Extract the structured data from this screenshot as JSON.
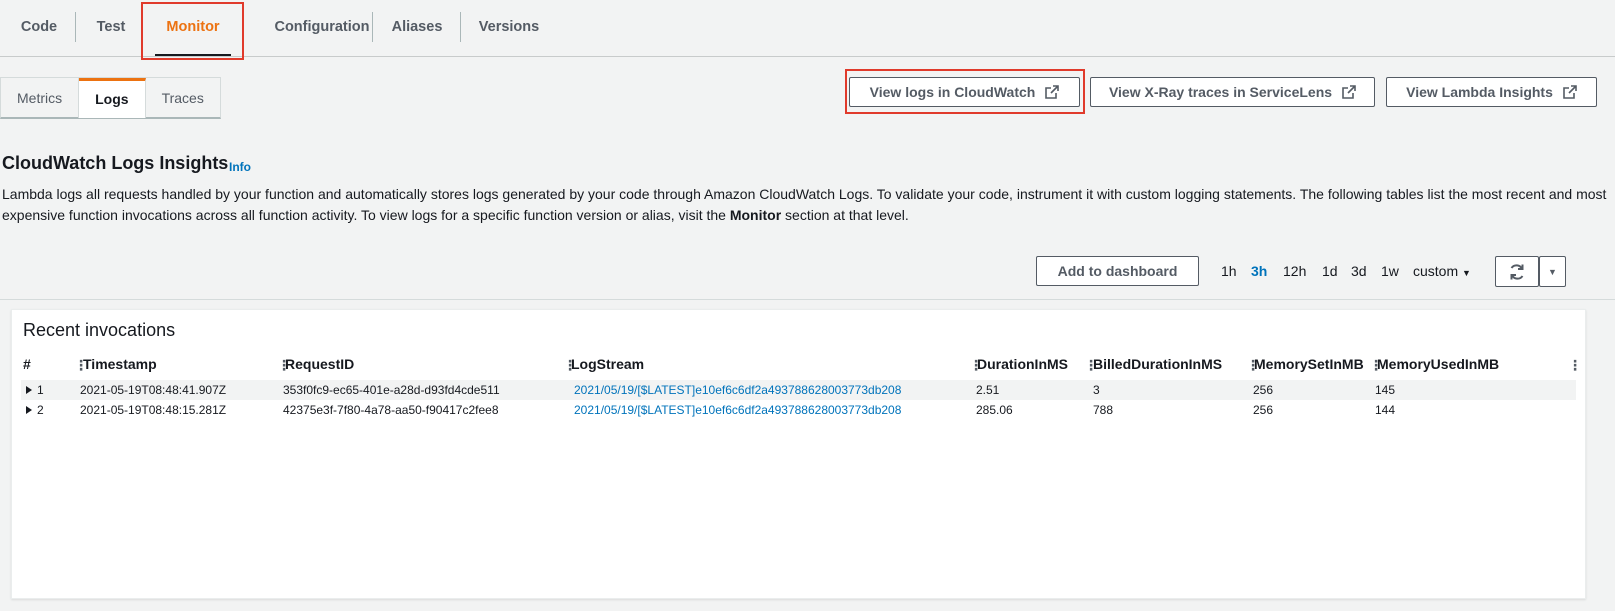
{
  "top_tabs": [
    {
      "label": "Code"
    },
    {
      "label": "Test"
    },
    {
      "label": "Monitor"
    },
    {
      "label": "Configuration"
    },
    {
      "label": "Aliases"
    },
    {
      "label": "Versions"
    }
  ],
  "sub_tabs": [
    {
      "label": "Metrics"
    },
    {
      "label": "Logs"
    },
    {
      "label": "Traces"
    }
  ],
  "actions": {
    "view_logs": "View logs in CloudWatch",
    "view_xray": "View X-Ray traces in ServiceLens",
    "view_insights": "View Lambda Insights"
  },
  "section": {
    "title": "CloudWatch Logs Insights",
    "info": "Info",
    "desc_part1": "Lambda logs all requests handled by your function and automatically stores logs generated by your code through Amazon CloudWatch Logs. To validate your code, instrument it with custom logging statements. The following tables list the most recent and most expensive function invocations across all function activity. To view logs for a specific function version or alias, visit the ",
    "desc_bold": "Monitor",
    "desc_part2": " section at that level."
  },
  "toolbar": {
    "add_dashboard": "Add to dashboard",
    "ranges": [
      "1h",
      "3h",
      "12h",
      "1d",
      "3d",
      "1w"
    ],
    "selected_range": "3h",
    "custom": "custom"
  },
  "table": {
    "title": "Recent invocations",
    "columns": [
      "#",
      "Timestamp",
      "RequestID",
      "LogStream",
      "DurationInMS",
      "BilledDurationInMS",
      "MemorySetInMB",
      "MemoryUsedInMB"
    ],
    "rows": [
      {
        "num": "1",
        "timestamp": "2021-05-19T08:48:41.907Z",
        "request_id": "353f0fc9-ec65-401e-a28d-d93fd4cde511",
        "log_stream": "2021/05/19/[$LATEST]e10ef6c6df2a493788628003773db208",
        "duration": "2.51",
        "billed": "3",
        "mem_set": "256",
        "mem_used": "145"
      },
      {
        "num": "2",
        "timestamp": "2021-05-19T08:48:15.281Z",
        "request_id": "42375e3f-7f80-4a78-aa50-f90417c2fee8",
        "log_stream": "2021/05/19/[$LATEST]e10ef6c6df2a493788628003773db208",
        "duration": "285.06",
        "billed": "788",
        "mem_set": "256",
        "mem_used": "144"
      }
    ]
  },
  "colors": {
    "accent": "#ec7211",
    "link": "#0073bb",
    "highlight": "#e03a2b"
  }
}
